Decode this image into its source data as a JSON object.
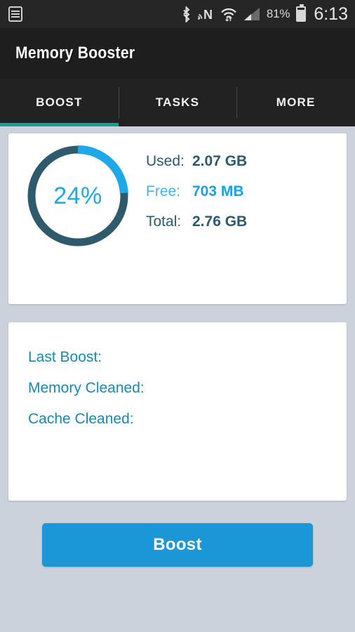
{
  "status_bar": {
    "notification_icon": "notification-list-icon",
    "icons": [
      "bluetooth-icon",
      "nfc-icon",
      "wifi-icon",
      "cellular-signal-icon"
    ],
    "battery_percent": "81%",
    "battery_icon": "battery-icon",
    "time": "6:13"
  },
  "app_bar": {
    "title": "Memory Booster"
  },
  "tabs": {
    "items": [
      {
        "label": "BOOST",
        "active": true
      },
      {
        "label": "TASKS",
        "active": false
      },
      {
        "label": "MORE",
        "active": false
      }
    ],
    "active_index": 0,
    "indicator_color": "#1a9e8f"
  },
  "memory_card": {
    "percent_label": "24%",
    "percent_value": 24,
    "arc_color": "#1fa8e8",
    "track_color": "#2e5a6b",
    "stats": [
      {
        "label": "Used:",
        "value": "2.07 GB",
        "highlight": false
      },
      {
        "label": "Free:",
        "value": "703 MB",
        "highlight": true
      },
      {
        "label": "Total:",
        "value": "2.76 GB",
        "highlight": false
      }
    ]
  },
  "info_card": {
    "rows": [
      {
        "label": "Last Boost:",
        "value": ""
      },
      {
        "label": "Memory Cleaned:",
        "value": ""
      },
      {
        "label": "Cache Cleaned:",
        "value": ""
      }
    ]
  },
  "boost_button": {
    "label": "Boost",
    "color": "#1b97d8"
  },
  "colors": {
    "page_background": "#cbd2dc",
    "card_background": "#ffffff",
    "accent_blue": "#1b97d8",
    "accent_teal": "#1a9e8f",
    "dark_slate": "#2b5a6e"
  }
}
